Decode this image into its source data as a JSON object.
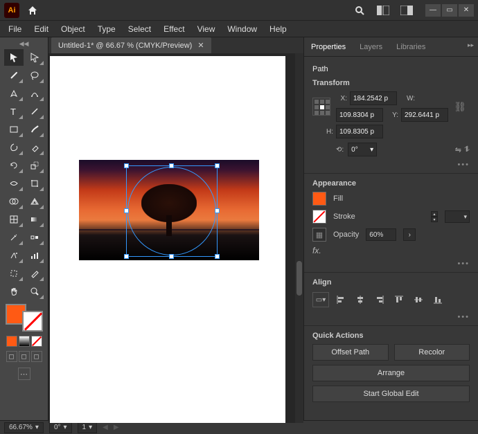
{
  "app": {
    "logo_text": "Ai"
  },
  "menu": [
    "File",
    "Edit",
    "Object",
    "Type",
    "Select",
    "Effect",
    "View",
    "Window",
    "Help"
  ],
  "doc_tab": {
    "label": "Untitled-1* @ 66.67 % (CMYK/Preview)"
  },
  "properties": {
    "tabs": [
      "Properties",
      "Layers",
      "Libraries"
    ],
    "selection_type": "Path",
    "transform_heading": "Transform",
    "x_label": "X:",
    "y_label": "Y:",
    "w_label": "W:",
    "h_label": "H:",
    "x": "184.2542 p",
    "y": "292.6441 p",
    "w": "109.8304 p",
    "h": "109.8305 p",
    "rotate_label": "⟲:",
    "rotate_value": "0°",
    "appearance_heading": "Appearance",
    "fill_label": "Fill",
    "stroke_label": "Stroke",
    "opacity_label": "Opacity",
    "opacity_value": "60%",
    "fx_label": "fx.",
    "align_heading": "Align",
    "quick_heading": "Quick Actions",
    "offset_path": "Offset Path",
    "recolor": "Recolor",
    "arrange": "Arrange",
    "start_global_edit": "Start Global Edit"
  },
  "status": {
    "zoom": "66.67%",
    "rotation": "0°",
    "artboard": "1"
  },
  "colors": {
    "fill": "#ff5a14",
    "accent": "#3399ff"
  }
}
